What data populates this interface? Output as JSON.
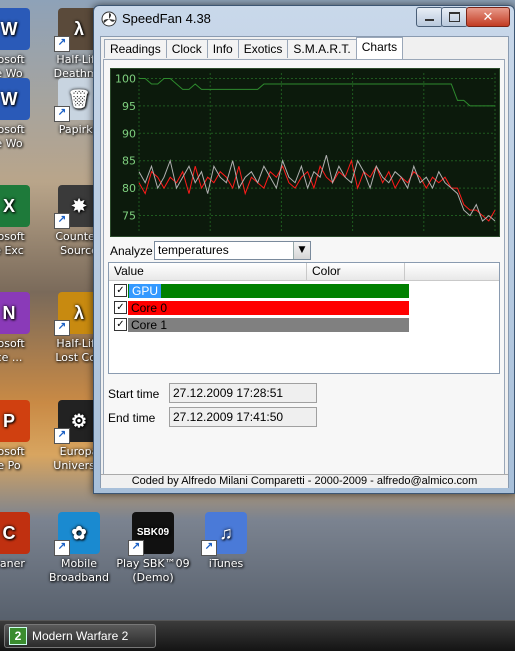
{
  "desktop": {
    "icons": [
      {
        "label": "Half-Life\nDeathma",
        "color": "#5a4a3a",
        "glyph": "λ"
      },
      {
        "label": "Papirku",
        "color": "#c8d4e0",
        "glyph": "🗑"
      },
      {
        "label": "Counter-\nSource",
        "color": "#3a3a3a",
        "glyph": "✸"
      },
      {
        "label": "Half-Life\nLost Coa",
        "color": "#c88a10",
        "glyph": "λ"
      },
      {
        "label": "Europa\nUniversal",
        "color": "#222222",
        "glyph": "⚙"
      },
      {
        "label": "Mobile\nBroadband",
        "color": "#1a8ad0",
        "glyph": "✿"
      },
      {
        "label": "Play SBK™09\n(Demo)",
        "color": "#111111",
        "glyph": "SBK09"
      },
      {
        "label": "iTunes",
        "color": "#4a7ad8",
        "glyph": "♫"
      },
      {
        "label": "rosoft\ne Wo",
        "color": "#2a5ab8",
        "glyph": "W"
      },
      {
        "label": "rosoft\ne Wo",
        "color": "#2a5ab8",
        "glyph": "W"
      },
      {
        "label": "rosoft\ne Exc",
        "color": "#1e7a3a",
        "glyph": "X"
      },
      {
        "label": "rosoft\nce ...",
        "color": "#8a3ab8",
        "glyph": "N"
      },
      {
        "label": "rosoft\ne Po",
        "color": "#d04010",
        "glyph": "P"
      },
      {
        "label": "eaner",
        "color": "#c03010",
        "glyph": "C"
      }
    ]
  },
  "taskbar": {
    "button_label": "Modern Warfare 2",
    "button_icon": "mw2-icon"
  },
  "window": {
    "title": "SpeedFan 4.38",
    "close_label": "✕",
    "tabs": [
      "Readings",
      "Clock",
      "Info",
      "Exotics",
      "S.M.A.R.T.",
      "Charts"
    ],
    "active_tab": "Charts",
    "analyze_label": "Analyze",
    "analyze_value": "temperatures",
    "list_headers": {
      "value": "Value",
      "color": "Color"
    },
    "series": [
      {
        "name": "GPU",
        "color": "#008000",
        "checked": true
      },
      {
        "name": "Core 0",
        "color": "#ff0000",
        "checked": true
      },
      {
        "name": "Core 1",
        "color": "#808080",
        "checked": true
      }
    ],
    "start_time_label": "Start time",
    "start_time_value": "27.12.2009 17:28:51",
    "end_time_label": "End time",
    "end_time_value": "27.12.2009 17:41:50",
    "status": "Coded by Alfredo Milani Comparetti - 2000-2009 - alfredo@almico.com"
  },
  "chart_data": {
    "type": "line",
    "y_ticks": [
      "100",
      "95",
      "90",
      "85",
      "80",
      "75"
    ],
    "ylim": [
      72,
      101
    ],
    "grid": true,
    "series": [
      {
        "name": "GPU",
        "color": "#2e8b2e",
        "values": [
          100,
          100,
          99,
          99,
          100,
          100,
          99,
          98,
          98,
          99,
          98,
          98,
          98,
          98,
          98,
          98,
          98,
          98,
          98,
          98,
          99,
          99,
          99,
          99,
          99,
          99,
          99,
          99,
          99,
          99,
          99,
          99,
          99,
          99,
          99,
          99,
          99,
          99,
          99,
          99,
          99,
          99,
          99,
          99,
          99,
          99,
          99,
          99,
          99,
          99,
          99,
          96,
          96,
          95,
          95,
          95,
          95,
          95
        ]
      },
      {
        "name": "Core 0",
        "color": "#ff1a1a",
        "values": [
          81,
          79,
          83,
          82,
          80,
          82,
          81,
          83,
          79,
          84,
          80,
          82,
          81,
          83,
          82,
          80,
          84,
          79,
          82,
          81,
          80,
          83,
          82,
          84,
          81,
          80,
          82,
          83,
          80,
          84,
          82,
          81,
          83,
          82,
          85,
          80,
          83,
          82,
          84,
          81,
          83,
          80,
          82,
          81,
          83,
          82,
          80,
          82,
          81,
          82,
          80,
          80,
          77,
          76,
          76,
          75,
          74,
          76
        ]
      },
      {
        "name": "Core 1",
        "color": "#b0b0b0",
        "values": [
          83,
          81,
          84,
          80,
          82,
          85,
          80,
          82,
          84,
          81,
          83,
          79,
          84,
          82,
          81,
          85,
          80,
          82,
          83,
          81,
          84,
          82,
          80,
          85,
          82,
          81,
          84,
          80,
          83,
          82,
          86,
          81,
          84,
          82,
          81,
          85,
          83,
          80,
          84,
          82,
          81,
          83,
          82,
          80,
          84,
          81,
          82,
          80,
          83,
          81,
          80,
          79,
          76,
          75,
          77,
          74,
          75,
          74
        ]
      }
    ]
  }
}
